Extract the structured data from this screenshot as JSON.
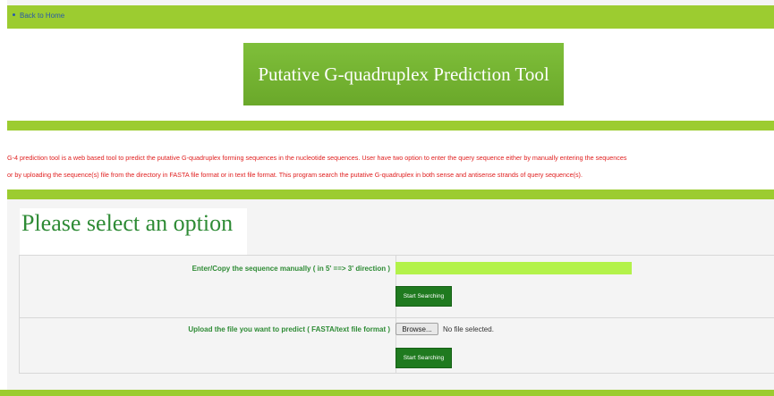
{
  "nav": {
    "back_link": "Back to Home"
  },
  "header": {
    "title": "Putative G-quadruplex Prediction Tool"
  },
  "description": {
    "line1": "G-4 prediction tool is a web based tool to predict the putative G-quadruplex forming sequences in the nucleotide sequences. User have two option to enter the query sequence either by manually entering the sequences",
    "line2": "or by uploading the sequence(s) file from the directory in FASTA file format or in text file format. This program search the putative G-quadruplex in both sense and antisense strands of query sequence(s)."
  },
  "form": {
    "heading": "Please select an option",
    "manual": {
      "label": "Enter/Copy the sequence manually ( in 5' ==> 3' direction )",
      "value": "",
      "button_label": "Start Searching"
    },
    "upload": {
      "label": "Upload the file you want to predict ( FASTA/text file format )",
      "browse_label": "Browse...",
      "file_status": "No file selected.",
      "button_label": "Start Searching"
    }
  },
  "colors": {
    "accent_green": "#9ccc30",
    "title_green": "#6aa82a",
    "button_green": "#1f7a1f",
    "text_green": "#2e8b35",
    "description_red": "#e02020",
    "input_bg": "#b3f24a"
  }
}
